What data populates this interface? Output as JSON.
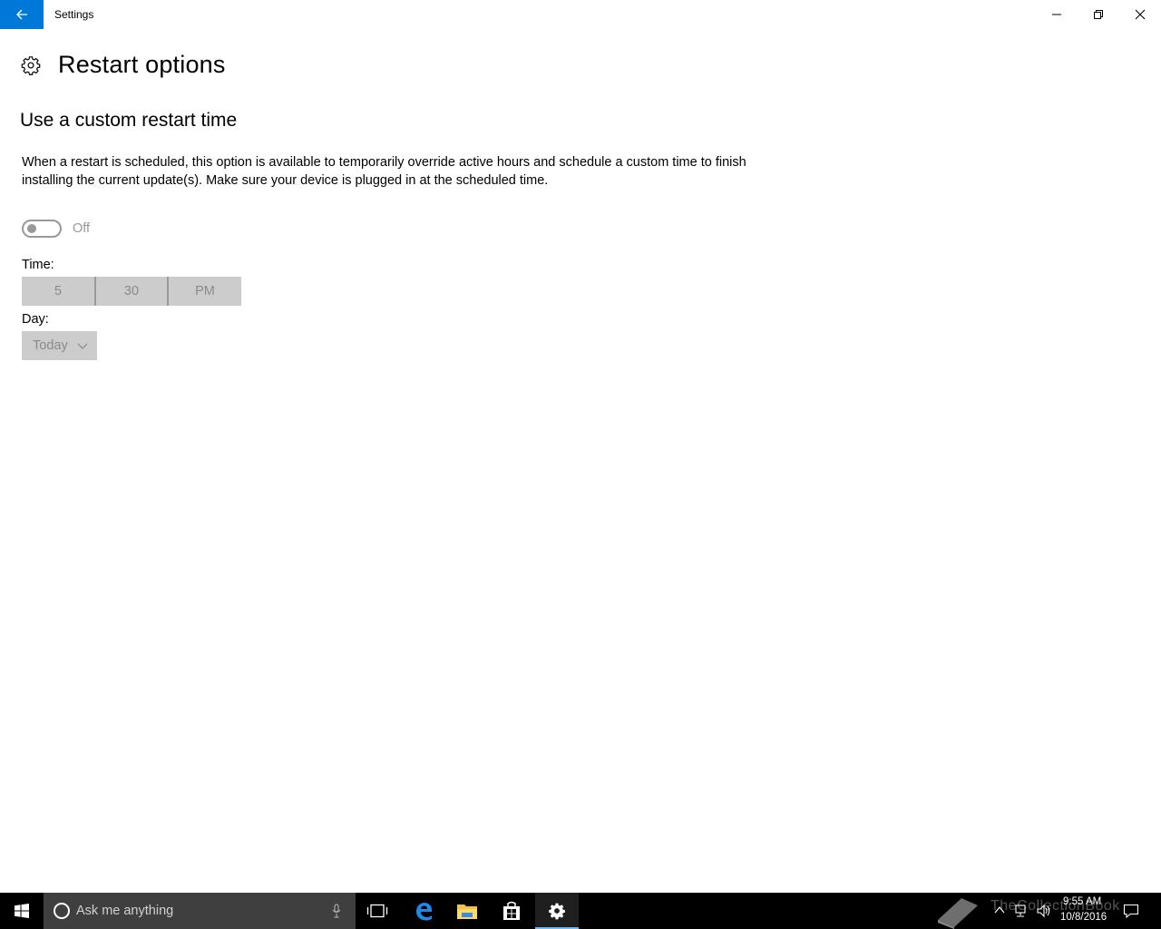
{
  "window": {
    "title": "Settings"
  },
  "page": {
    "title": "Restart options",
    "section_title": "Use a custom restart time",
    "description": "When a restart is scheduled, this option is available to temporarily override active hours and schedule a custom time to finish installing the current update(s). Make sure your device is plugged in at the scheduled time.",
    "toggle": {
      "state_label": "Off",
      "on": false
    },
    "time_label": "Time:",
    "time": {
      "hour": "5",
      "minute": "30",
      "period": "PM"
    },
    "day_label": "Day:",
    "day": {
      "selected": "Today"
    }
  },
  "taskbar": {
    "search_placeholder": "Ask me anything",
    "clock_time": "9:55 AM",
    "clock_date": "10/8/2016",
    "watermark_text": "TheCollectionBook"
  },
  "colors": {
    "accent": "#0078d7",
    "taskbar": "#000000",
    "search_box": "#3f3f3f",
    "disabled_control": "#cccccc"
  }
}
